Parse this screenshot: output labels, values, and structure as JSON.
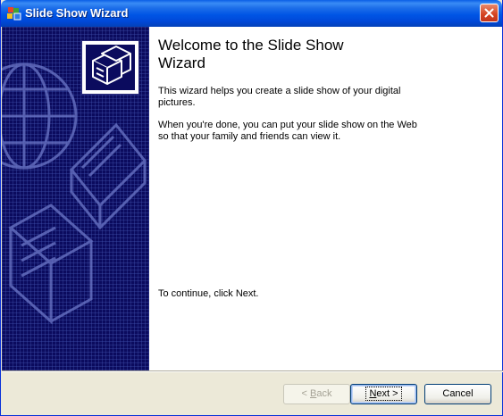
{
  "window": {
    "title": "Slide Show Wizard",
    "close_symbol": "✕"
  },
  "content": {
    "heading_line1": "Welcome to the Slide Show",
    "heading_line2": "Wizard",
    "intro_line1": "This wizard helps you create a slide show of your digital",
    "intro_line2": "pictures.",
    "publish_line1": "When you're done, you can put your slide show on the Web",
    "publish_line2": "so that your family and friends can view it.",
    "continue_text": "To continue, click Next."
  },
  "buttons": {
    "back_prefix": "< ",
    "back_accel": "B",
    "back_rest": "ack",
    "next_accel": "N",
    "next_rest": "ext >",
    "cancel_label": "Cancel"
  },
  "icons": {
    "app": "slideshow-wizard-icon",
    "close": "close-icon",
    "banner_logo": "camera-stack-icon",
    "side_art": [
      "globe-icon",
      "photo-printer-icon",
      "camera-icon"
    ]
  },
  "colors": {
    "titlebar": "#0055e5",
    "side_panel": "#0b0b5e",
    "close_button": "#d4421f",
    "dialog_bg": "#ece9d8"
  }
}
